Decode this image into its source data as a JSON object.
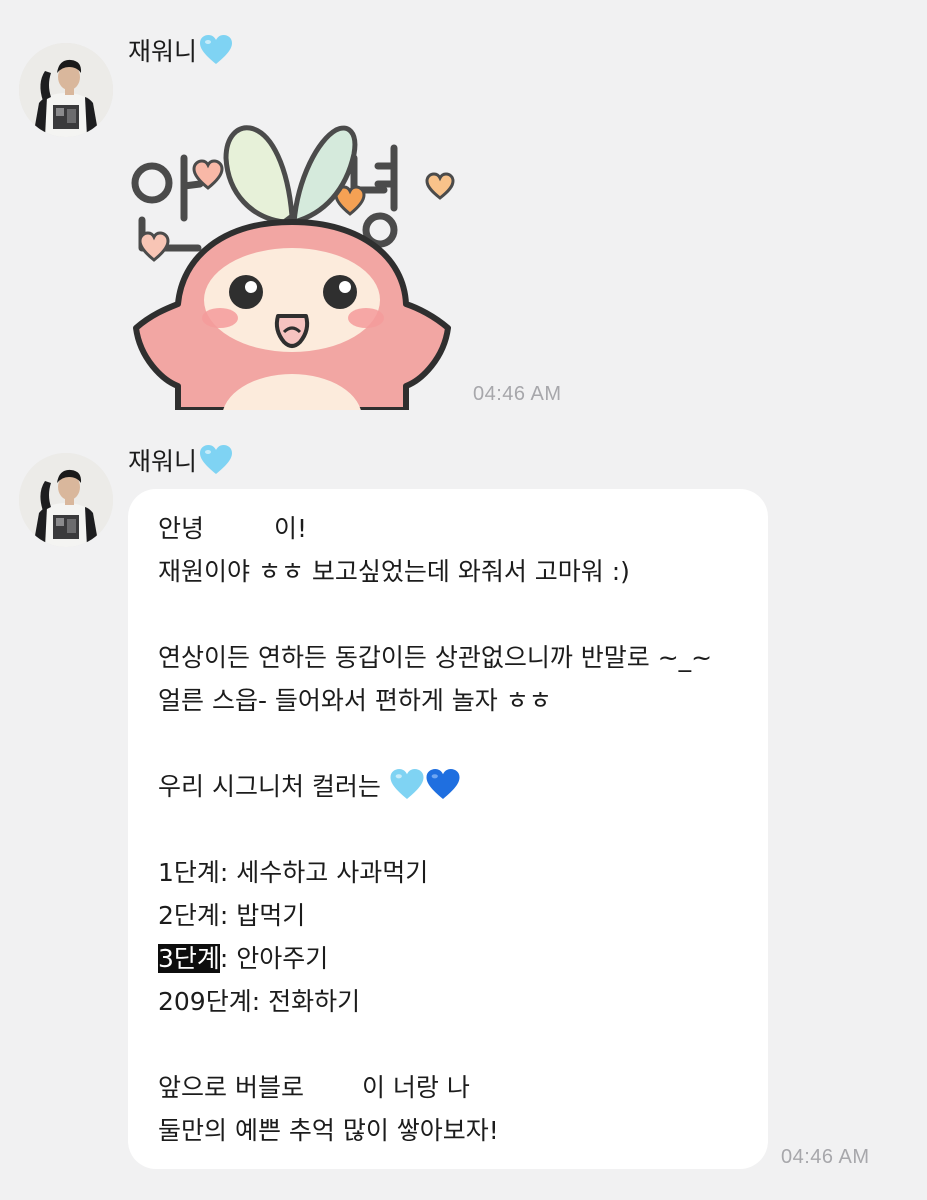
{
  "messages": [
    {
      "sender": "재워니",
      "sender_emoji": "light-blue-heart",
      "type": "sticker",
      "sticker_text": [
        "안",
        "녕"
      ],
      "time": "04:46 AM"
    },
    {
      "sender": "재워니",
      "sender_emoji": "light-blue-heart",
      "type": "text",
      "time": "04:46 AM",
      "lines": {
        "l1_a": "안녕",
        "l1_b": "이!",
        "l2": "재원이야 ㅎㅎ 보고싶었는데 와줘서 고마워 :)",
        "l4": "연상이든 연하든 동갑이든 상관없으니까 반말로 ~_~",
        "l5": "얼른 스읍- 들어와서 편하게 놀자 ㅎㅎ",
        "l7": "우리 시그니처 컬러는",
        "l9": "1단계: 세수하고 사과먹기",
        "l10": "2단계: 밥먹기",
        "l11_hl": "3단계",
        "l11_rest": ": 안아주기",
        "l12": "209단계: 전화하기",
        "l14_a": "앞으로 버블로",
        "l14_b": "이 너랑 나",
        "l15": "둘만의 예쁜 추억 많이 쌓아보자!"
      },
      "emojis": [
        "light-blue-heart",
        "blue-heart"
      ]
    }
  ],
  "colors": {
    "background": "#f1f1f2",
    "bubble": "#ffffff",
    "timestamp": "#a7a7ab",
    "light_blue_heart": "#7fd3f3",
    "blue_heart": "#1f6fe0",
    "highlight": "#0d0d0d"
  }
}
